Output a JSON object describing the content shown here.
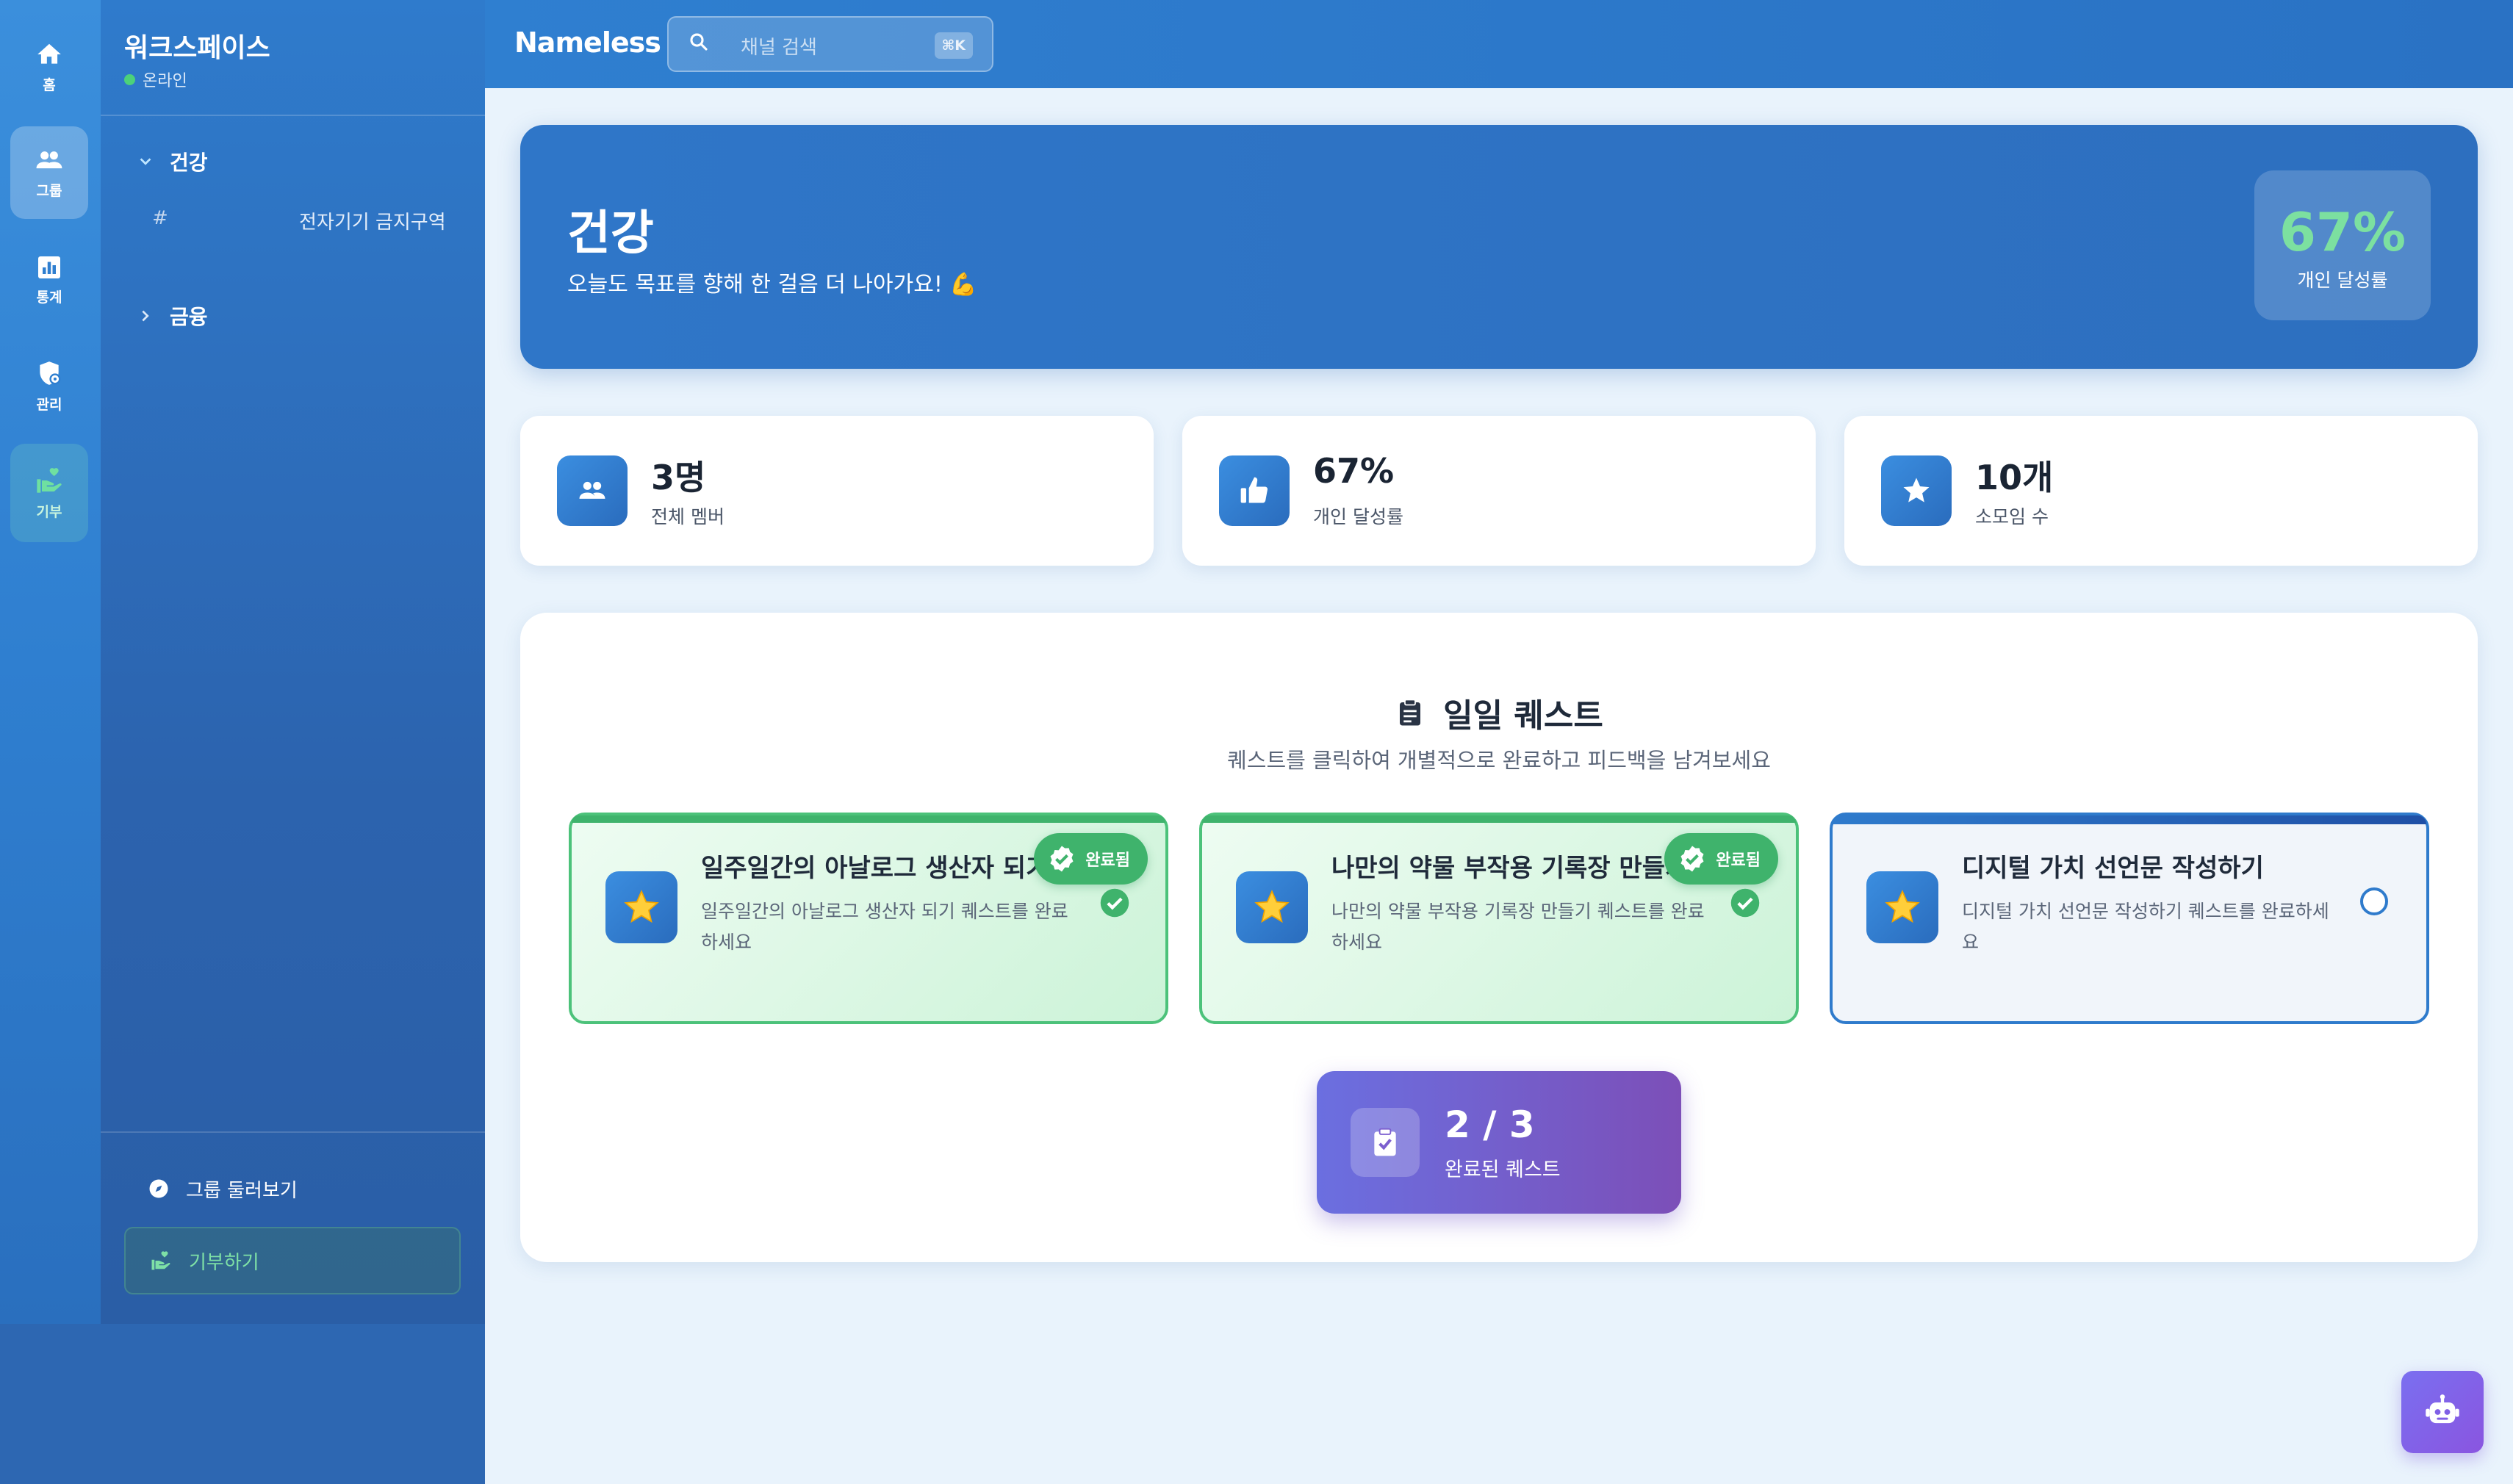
{
  "rail": {
    "items": [
      {
        "label": "홈",
        "icon": "home-icon"
      },
      {
        "label": "그룹",
        "icon": "group-icon"
      },
      {
        "label": "통계",
        "icon": "stats-icon"
      },
      {
        "label": "관리",
        "icon": "shield-icon"
      },
      {
        "label": "기부",
        "icon": "donate-icon"
      }
    ]
  },
  "sidebar": {
    "workspace_title": "워크스페이스",
    "status": "온라인",
    "categories": [
      {
        "name": "건강",
        "expanded": true,
        "channels": [
          {
            "prefix": "#",
            "name": "전자기기 금지구역"
          }
        ]
      },
      {
        "name": "금융",
        "expanded": false
      }
    ],
    "footer": {
      "browse_label": "그룹 둘러보기",
      "donate_label": "기부하기"
    }
  },
  "topbar": {
    "brand": "Nameless",
    "search_placeholder": "채널 검색",
    "search_shortcut": "⌘K"
  },
  "hero": {
    "title": "건강",
    "subtitle": "오늘도 목표를 향해 한 걸음 더 나아가요! 💪",
    "rate_value": "67%",
    "rate_label": "개인 달성률"
  },
  "stats": [
    {
      "value": "3명",
      "label": "전체 멤버",
      "icon": "members-icon"
    },
    {
      "value": "67%",
      "label": "개인 달성률",
      "icon": "thumbs-up-icon"
    },
    {
      "value": "10개",
      "label": "소모임 수",
      "icon": "star-icon"
    }
  ],
  "quests": {
    "title": "일일 퀘스트",
    "subtitle": "퀘스트를 클릭하여 개별적으로 완료하고 피드백을 남겨보세요",
    "done_badge": "완료됨",
    "items": [
      {
        "title": "일주일간의 아날로그 생산자 되기",
        "desc": "일주일간의 아날로그 생산자 되기 퀘스트를 완료하세요",
        "done": true
      },
      {
        "title": "나만의 약물 부작용 기록장 만들기",
        "desc": "나만의 약물 부작용 기록장 만들기 퀘스트를 완료하세요",
        "done": true
      },
      {
        "title": "디지털 가치 선언문 작성하기",
        "desc": "디지털 가치 선언문 작성하기 퀘스트를 완료하세요",
        "done": false
      }
    ],
    "progress_value": "2 / 3",
    "progress_label": "완료된 퀘스트"
  },
  "colors": {
    "primary": "#2f7bcc",
    "success": "#3fb36c",
    "accent_purple": "#7c4fb8"
  }
}
